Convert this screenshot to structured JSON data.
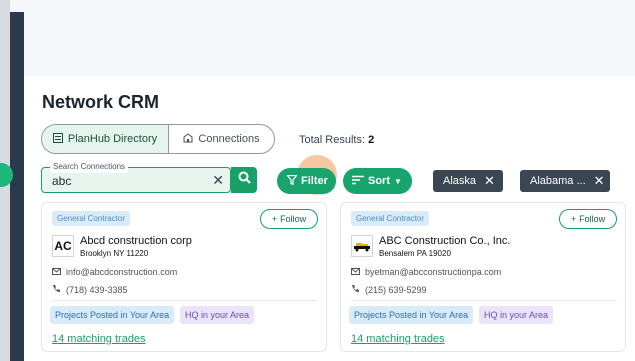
{
  "page": {
    "title": "Network CRM"
  },
  "tabs": [
    {
      "label": "PlanHub Directory",
      "icon": "directory-icon",
      "active": true
    },
    {
      "label": "Connections",
      "icon": "building-icon",
      "active": false
    }
  ],
  "results": {
    "label": "Total Results:",
    "count": "2"
  },
  "search": {
    "legend": "Search Connections",
    "value": "abc"
  },
  "filter_label": "Filter",
  "sort_label": "Sort",
  "chips": [
    {
      "label": "Alaska"
    },
    {
      "label": "Alabama ..."
    }
  ],
  "follow_label": "Follow",
  "cards": [
    {
      "type_badge": "General Contractor",
      "logo_text": "AC",
      "name": "Abcd construction corp",
      "location": "Brooklyn NY 11220",
      "email": "info@abcdconstruction.com",
      "phone": "(718) 439-3385",
      "tags": [
        "Projects Posted in Your Area",
        "HQ in your Area"
      ],
      "trades": "14 matching trades"
    },
    {
      "type_badge": "General Contractor",
      "logo_text": "",
      "name": "ABC Construction Co., Inc.",
      "location": "Bensalem PA 19020",
      "email": "byetman@abcconstructionpa.com",
      "phone": "(215) 639-5299",
      "tags": [
        "Projects Posted in Your Area",
        "HQ in your Area"
      ],
      "trades": "14 matching trades"
    }
  ],
  "colors": {
    "accent": "#19a46d",
    "chip": "#3a4652",
    "rail": "#2b3a4a"
  }
}
